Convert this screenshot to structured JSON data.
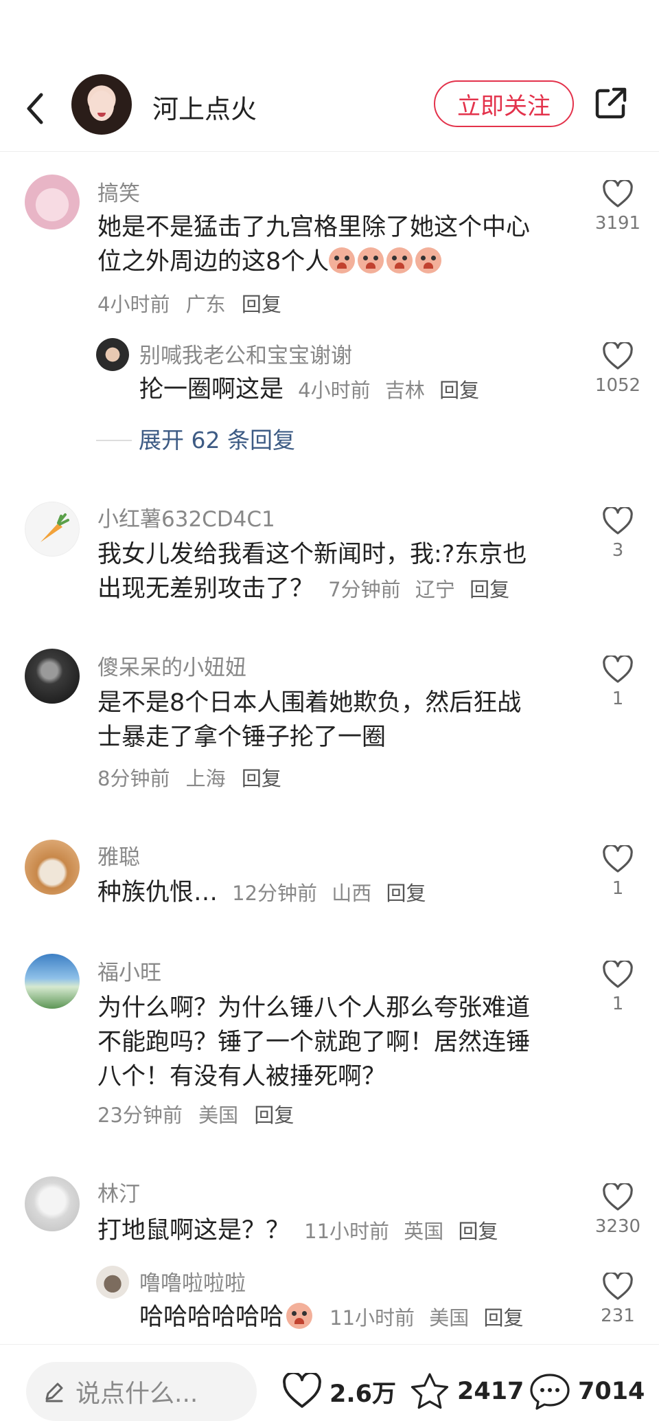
{
  "header": {
    "author_name": "河上点火",
    "follow_label": "立即关注"
  },
  "comments": [
    {
      "username": "搞笑",
      "text_line1": "她是不是猛击了九宫格里除了她这个中心",
      "text_line2": "位之外周边的这8个人",
      "time": "4小时前",
      "location": "广东",
      "reply_label": "回复",
      "likes": "3191",
      "replies": [
        {
          "username": "别喊我老公和宝宝谢谢",
          "text": "抡一圈啊这是",
          "time": "4小时前",
          "location": "吉林",
          "reply_label": "回复",
          "likes": "1052"
        }
      ],
      "expand_label": "展开 62 条回复"
    },
    {
      "username": "小红薯632CD4C1",
      "text_line1": "我女儿发给我看这个新闻时，我:?东京也",
      "text_line2": "出现无差别攻击了？",
      "time": "7分钟前",
      "location": "辽宁",
      "reply_label": "回复",
      "likes": "3"
    },
    {
      "username": "傻呆呆的小妞妞",
      "text_line1": "是不是8个日本人围着她欺负，然后狂战",
      "text_line2": "士暴走了拿个锤子抡了一圈",
      "time": "8分钟前",
      "location": "上海",
      "reply_label": "回复",
      "likes": "1"
    },
    {
      "username": "雅聪",
      "text_line1": "种族仇恨…",
      "time": "12分钟前",
      "location": "山西",
      "reply_label": "回复",
      "likes": "1"
    },
    {
      "username": "福小旺",
      "text_line1": "为什么啊？为什么锤八个人那么夸张难道",
      "text_line2": "不能跑吗？锤了一个就跑了啊！居然连锤",
      "text_line3": "八个！有没有人被捶死啊？",
      "time": "23分钟前",
      "location": "美国",
      "reply_label": "回复",
      "likes": "1"
    },
    {
      "username": "林汀",
      "text_line1": "打地鼠啊这是？？",
      "time": "11小时前",
      "location": "英国",
      "reply_label": "回复",
      "likes": "3230",
      "replies": [
        {
          "username": "噜噜啦啦啦",
          "text": "哈哈哈哈哈哈",
          "time": "11小时前",
          "location": "美国",
          "reply_label": "回复",
          "likes": "231"
        }
      ]
    }
  ],
  "bottom_bar": {
    "input_placeholder": "说点什么...",
    "likes": "2.6万",
    "favorites": "2417",
    "comments": "7014"
  },
  "colors": {
    "accent": "#e3324b",
    "link": "#3d5b84",
    "muted": "#888888"
  },
  "icons": [
    "back-icon",
    "share-icon",
    "heart-icon",
    "star-icon",
    "comment-icon",
    "pencil-icon"
  ]
}
